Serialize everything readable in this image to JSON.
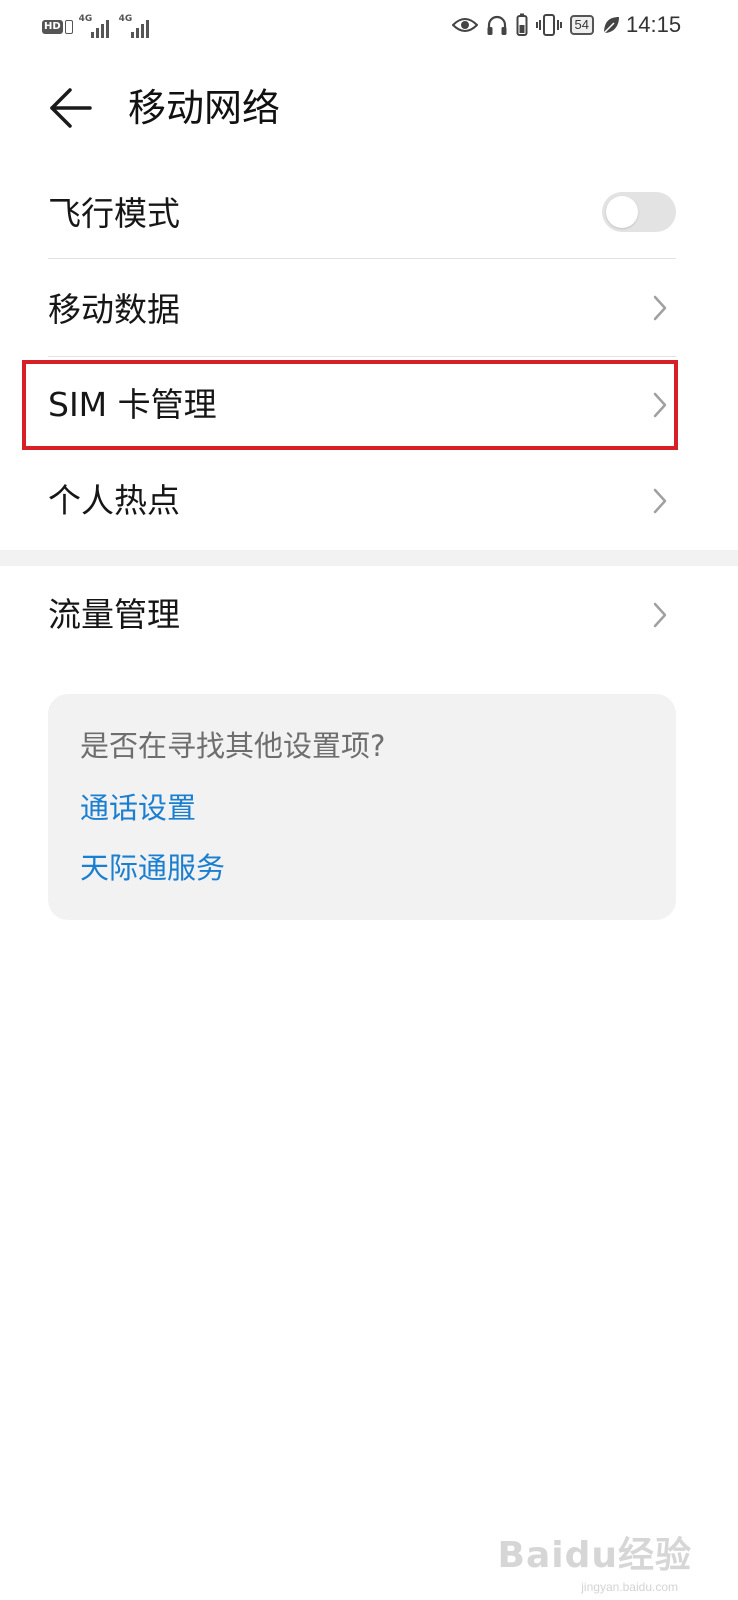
{
  "status_bar": {
    "hd_label": "HD",
    "sim1_network": "4G",
    "sim2_network": "4G",
    "battery_level": "54",
    "time": "14:15",
    "icons": [
      "eye-icon",
      "headphones-icon",
      "battery-saver-icon",
      "vibrate-icon",
      "battery-icon",
      "leaf-icon"
    ]
  },
  "header": {
    "title": "移动网络"
  },
  "settings": {
    "airplane_mode": {
      "label": "飞行模式",
      "enabled": false
    },
    "mobile_data": {
      "label": "移动数据"
    },
    "sim_management": {
      "label": "SIM 卡管理"
    },
    "hotspot": {
      "label": "个人热点"
    },
    "data_usage": {
      "label": "流量管理"
    }
  },
  "suggestion_card": {
    "question": "是否在寻找其他设置项?",
    "links": [
      "通话设置",
      "天际通服务"
    ]
  },
  "watermark": {
    "brand": "Baidu经验",
    "url": "jingyan.baidu.com"
  },
  "colors": {
    "link": "#1a7fd0",
    "highlight": "#d61f26",
    "card_bg": "#f2f2f2",
    "toggle_off": "#e3e3e3"
  }
}
